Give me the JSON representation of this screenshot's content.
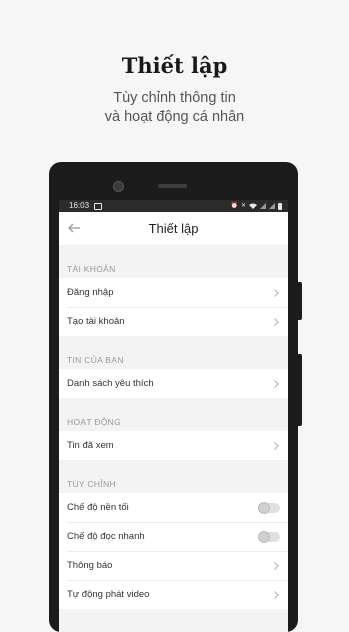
{
  "promo": {
    "title": "Thiết lập",
    "subtitle_line1": "Tùy chỉnh thông tin",
    "subtitle_line2": "và hoạt động cá nhân"
  },
  "statusbar": {
    "time": "16:03"
  },
  "appbar": {
    "title": "Thiết lập"
  },
  "sections": {
    "account": {
      "header": "TÀI KHOẢN",
      "items": [
        "Đăng nhập",
        "Tạo tài khoản"
      ]
    },
    "news": {
      "header": "TIN CỦA BẠN",
      "items": [
        "Danh sách yêu thích"
      ]
    },
    "activity": {
      "header": "HOẠT ĐỘNG",
      "items": [
        "Tin đã xem"
      ]
    },
    "custom": {
      "header": "TÙY CHỈNH",
      "items": [
        "Chế độ nền tối",
        "Chế độ đọc nhanh",
        "Thông báo",
        "Tự động phát video"
      ],
      "dark_mode_on": false,
      "fast_read_on": false
    }
  }
}
